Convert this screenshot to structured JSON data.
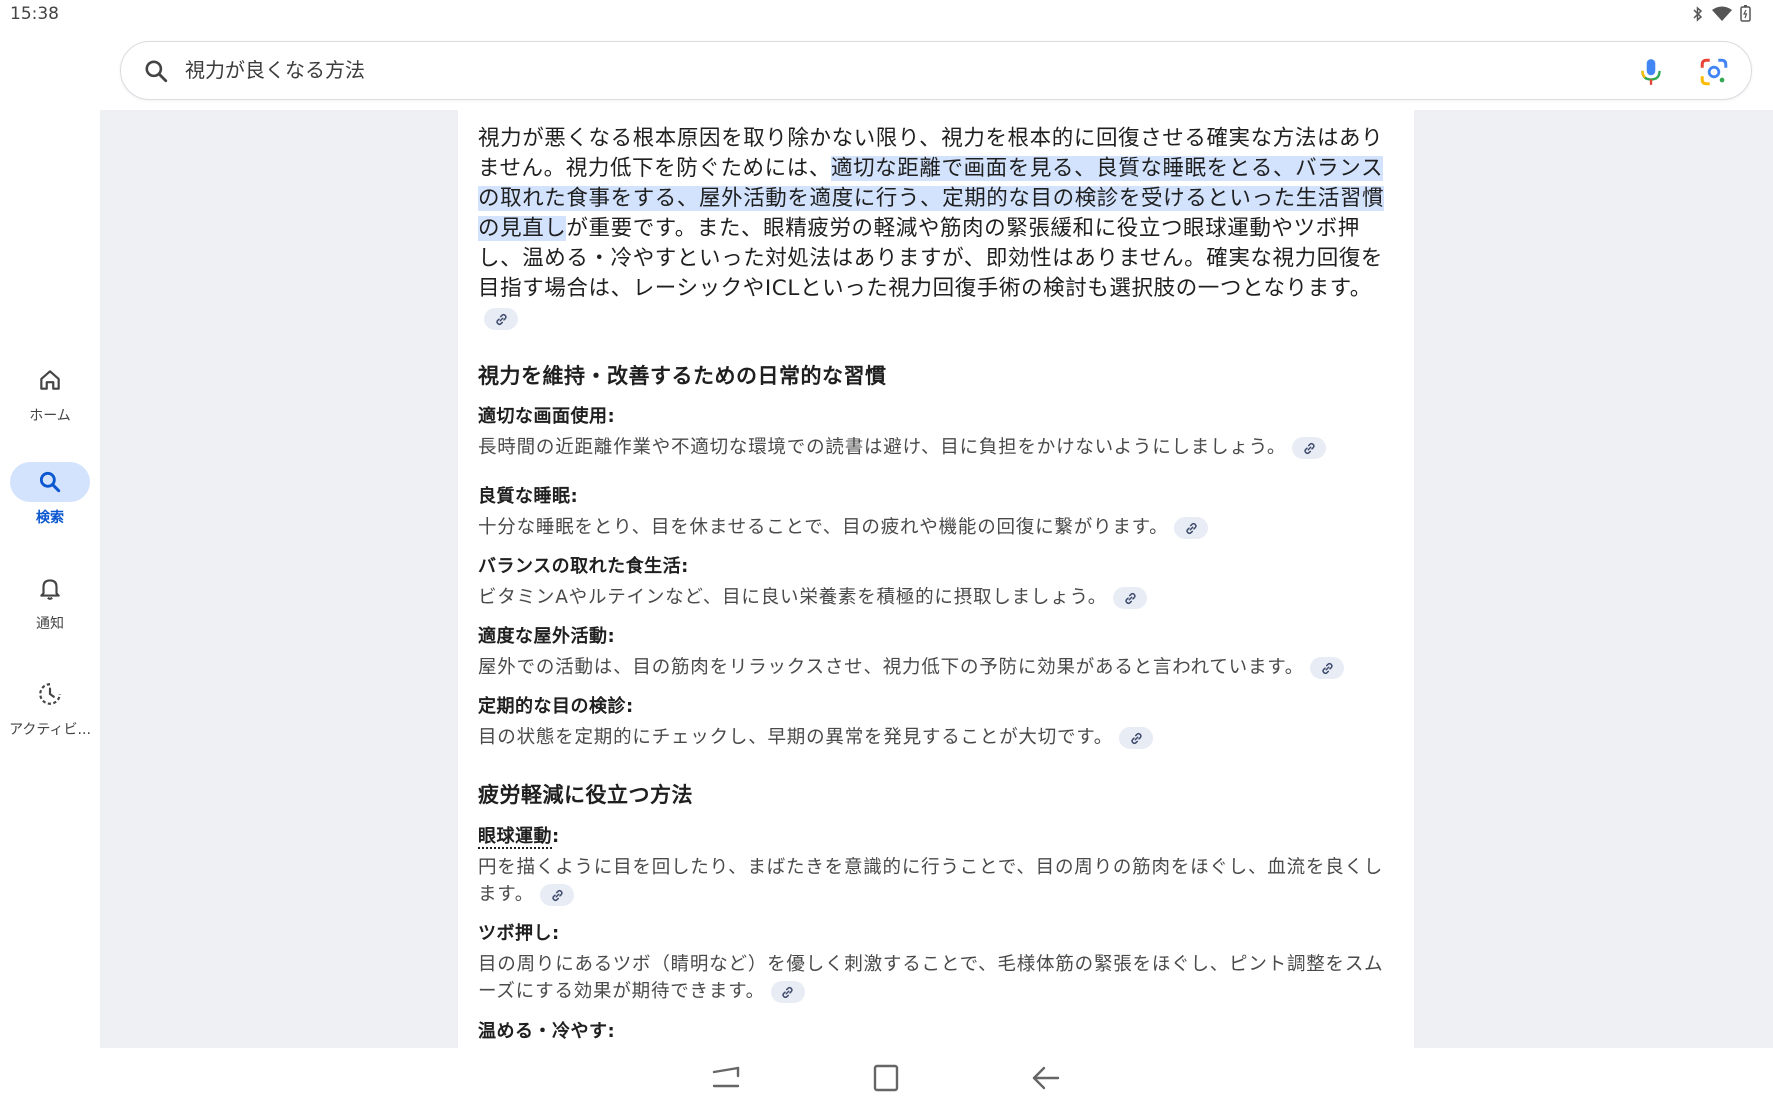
{
  "status": {
    "time": "15:38",
    "icons": [
      "bluetooth-icon",
      "wifi-icon",
      "battery-icon"
    ]
  },
  "search": {
    "query": "視力が良くなる方法"
  },
  "rail": {
    "items": [
      {
        "label": "ホーム",
        "icon": "home-icon",
        "active": false
      },
      {
        "label": "検索",
        "icon": "search-icon",
        "active": true
      },
      {
        "label": "通知",
        "icon": "bell-icon",
        "active": false
      },
      {
        "label": "アクティビ...",
        "icon": "activity-icon",
        "active": false
      }
    ]
  },
  "answer": {
    "intro_before": "視力が悪くなる根本原因を取り除かない限り、視力を根本的に回復させる確実な方法はありません。視力低下を防ぐためには、",
    "intro_highlight": "適切な距離で画面を見る、良質な睡眠をとる、バランスの取れた食事をする、屋外活動を適度に行う、定期的な目の検診を受けるといった生活習慣の見直し",
    "intro_after": "が重要です。また、眼精疲労の軽減や筋肉の緊張緩和に役立つ眼球運動やツボ押し、温める・冷やすといった対処法はありますが、即効性はありません。確実な視力回復を目指す場合は、レーシックやICLといった視力回復手術の検討も選択肢の一つとなります。",
    "section1_title": "視力を維持・改善するための日常的な習慣",
    "section1_items": [
      {
        "title": "適切な画面使用:",
        "desc": "長時間の近距離作業や不適切な環境での読書は避け、目に負担をかけないようにしましょう。"
      },
      {
        "title": "良質な睡眠:",
        "desc": "十分な睡眠をとり、目を休ませることで、目の疲れや機能の回復に繋がります。"
      },
      {
        "title": "バランスの取れた食生活:",
        "desc": "ビタミンAやルテインなど、目に良い栄養素を積極的に摂取しましょう。"
      },
      {
        "title": "適度な屋外活動:",
        "desc": "屋外での活動は、目の筋肉をリラックスさせ、視力低下の予防に効果があると言われています。"
      },
      {
        "title": "定期的な目の検診:",
        "desc": "目の状態を定期的にチェックし、早期の異常を発見することが大切です。"
      }
    ],
    "section2_title": "疲労軽減に役立つ方法",
    "section2_items": [
      {
        "title_linked": "眼球運動",
        "title_suffix": ":",
        "desc": "円を描くように目を回したり、まばたきを意識的に行うことで、目の周りの筋肉をほぐし、血流を良くします。"
      },
      {
        "title": "ツボ押し:",
        "desc": "目の周りにあるツボ（睛明など）を優しく刺激することで、毛様体筋の緊張をほぐし、ピント調整をスムーズにする効果が期待できます。"
      },
      {
        "title": "温める・冷やす:"
      }
    ]
  },
  "colors": {
    "highlight": "#d3e3fd",
    "accent": "#0b57d0",
    "content_bg": "#eef0f3"
  }
}
